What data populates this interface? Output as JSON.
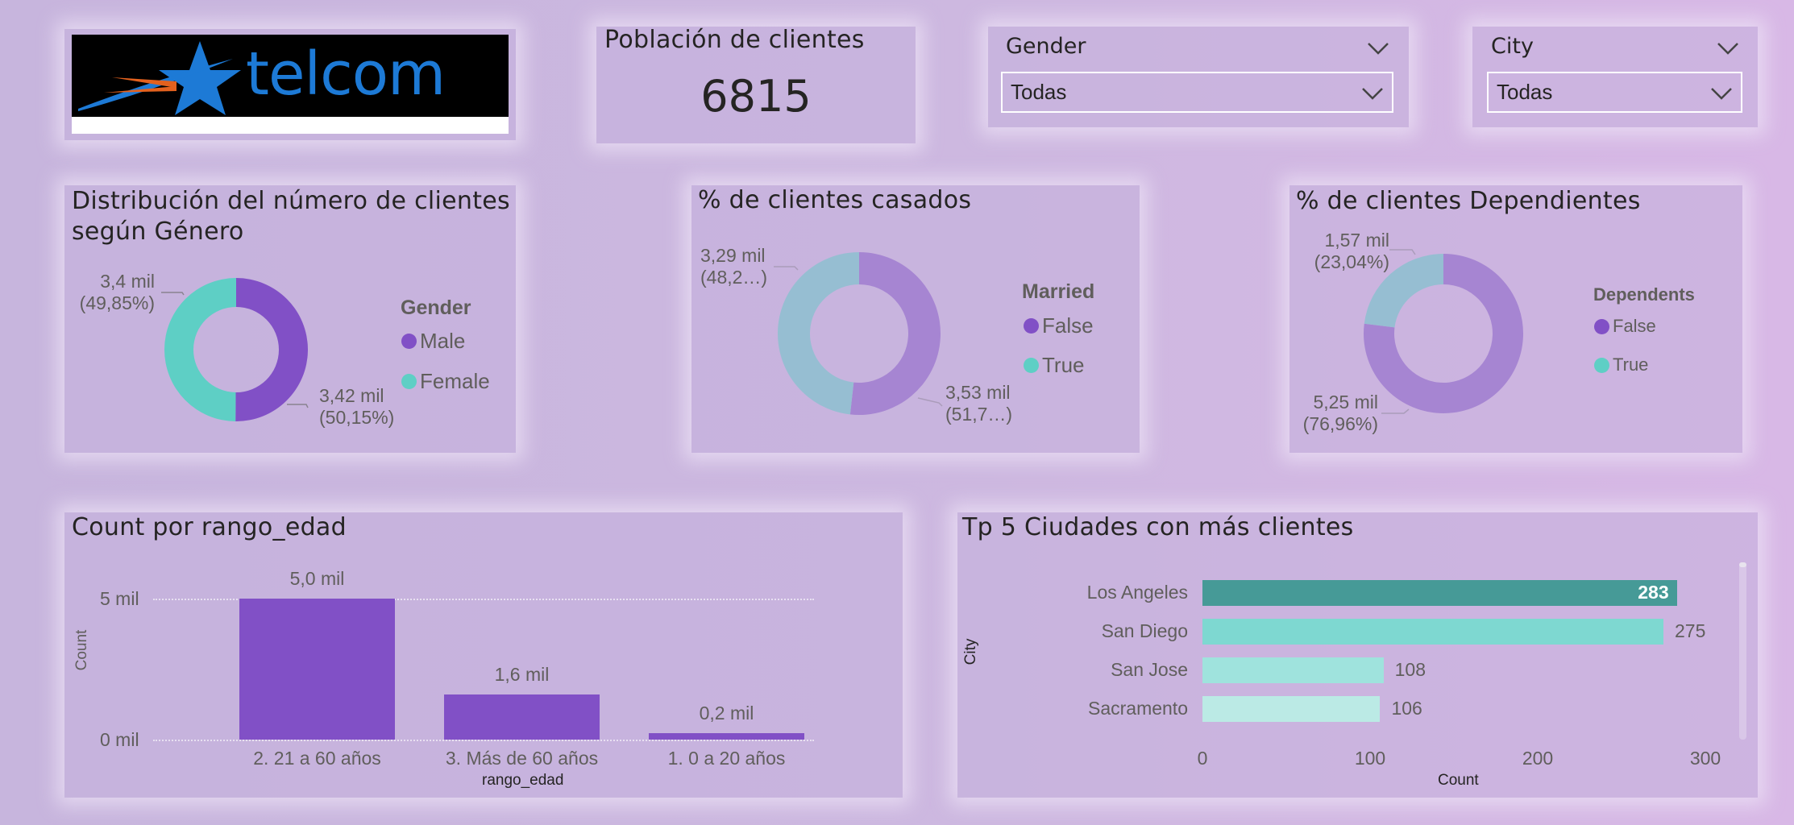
{
  "logo": {
    "text": "telcom"
  },
  "kpi": {
    "title": "Población de clientes",
    "value": "6815"
  },
  "slicers": {
    "gender": {
      "label": "Gender",
      "selected": "Todas"
    },
    "city": {
      "label": "City",
      "selected": "Todas"
    }
  },
  "colors": {
    "purple": "#8150c6",
    "teal": "#5ecfc5",
    "teal_dark": "#469a97",
    "teal_mid": "#7ed8d1",
    "teal_light": "#9fe3dd",
    "teal_lightest": "#bbeae5"
  },
  "chart_data": [
    {
      "type": "pie",
      "title": "Distribución del número de clientes según Género",
      "legend_title": "Gender",
      "categories": [
        "Male",
        "Female"
      ],
      "values": [
        3420,
        3400
      ],
      "labels": [
        "3,42 mil",
        "3,4 mil"
      ],
      "pct_labels": [
        "(50,15%)",
        "(49,85%)"
      ]
    },
    {
      "type": "pie",
      "title": "% de clientes casados",
      "legend_title": "Married",
      "categories": [
        "False",
        "True"
      ],
      "values": [
        3530,
        3290
      ],
      "labels": [
        "3,53 mil",
        "3,29 mil"
      ],
      "pct_labels": [
        "(51,7…)",
        "(48,2…)"
      ]
    },
    {
      "type": "pie",
      "title": "% de clientes Dependientes",
      "legend_title": "Dependents",
      "categories": [
        "False",
        "True"
      ],
      "values": [
        5250,
        1570
      ],
      "labels": [
        "5,25 mil",
        "1,57 mil"
      ],
      "pct_labels": [
        "(76,96%)",
        "(23,04%)"
      ]
    },
    {
      "type": "bar",
      "title": "Count por rango_edad",
      "xlabel": "rango_edad",
      "ylabel": "Count",
      "categories": [
        "2. 21 a 60 años",
        "3. Más de 60 años",
        "1. 0 a 20 años"
      ],
      "values": [
        5000,
        1600,
        200
      ],
      "data_labels": [
        "5,0 mil",
        "1,6 mil",
        "0,2 mil"
      ],
      "yticks": [
        "0 mil",
        "5 mil"
      ],
      "ylim": [
        0,
        5000
      ]
    },
    {
      "type": "bar",
      "orientation": "horizontal",
      "title": "Tp 5 Ciudades con más clientes",
      "xlabel": "Count",
      "ylabel": "City",
      "categories": [
        "Los Angeles",
        "San Diego",
        "San Jose",
        "Sacramento"
      ],
      "values": [
        283,
        275,
        108,
        106
      ],
      "xticks": [
        "0",
        "100",
        "200",
        "300"
      ],
      "xlim": [
        0,
        300
      ]
    }
  ]
}
